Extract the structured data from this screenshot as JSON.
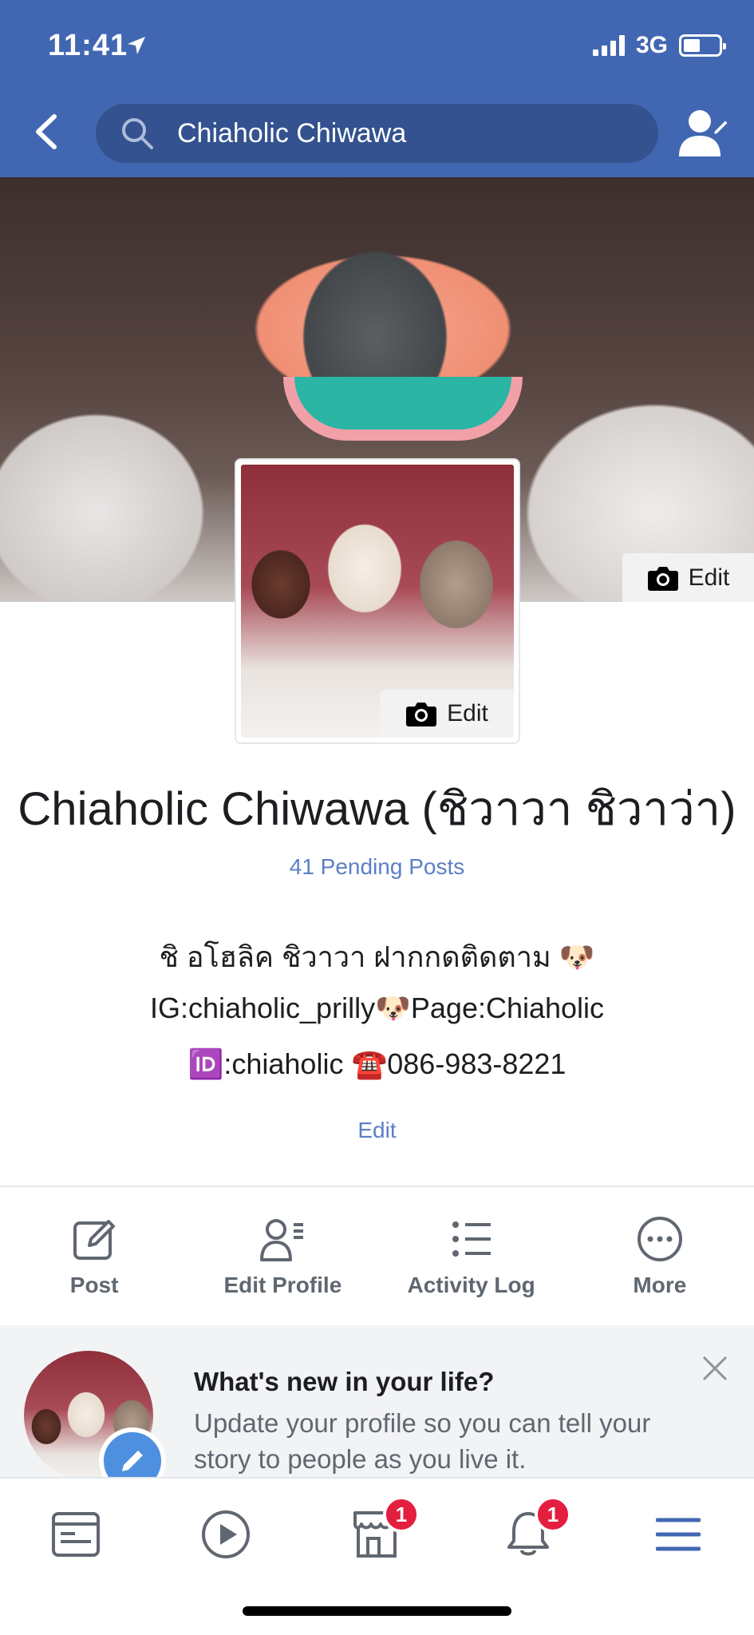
{
  "status_bar": {
    "time": "11:41",
    "network": "3G"
  },
  "header": {
    "search_text": "Chiaholic Chiwawa",
    "icons": [
      "back-chevron-icon",
      "search-icon",
      "profile-switch-icon"
    ],
    "background_color": "#4267b2"
  },
  "cover": {
    "edit_label": "Edit"
  },
  "profile_picture": {
    "edit_label": "Edit"
  },
  "profile": {
    "name": "Chiaholic Chiwawa (ชิวาวา ชิวาว่า)",
    "pending_posts": "41 Pending Posts",
    "bio_line1": "ชิ อโฮลิค ชิวาวา ฝากกดติดตาม 🐶",
    "bio_line2": "IG:chiaholic_prilly🐶Page:Chiaholic",
    "bio_line3": "🆔:chiaholic ☎️086-983-8221",
    "edit_label": "Edit"
  },
  "actions": [
    {
      "label": "Post",
      "icon": "compose-icon"
    },
    {
      "label": "Edit Profile",
      "icon": "edit-profile-icon"
    },
    {
      "label": "Activity Log",
      "icon": "list-icon"
    },
    {
      "label": "More",
      "icon": "more-icon"
    }
  ],
  "composer": {
    "title": "What's new in your life?",
    "subtitle": "Update your profile so you can tell your story to people as you live it."
  },
  "tabbar": {
    "tabs": [
      {
        "icon": "news-feed-icon"
      },
      {
        "icon": "watch-icon"
      },
      {
        "icon": "marketplace-icon",
        "badge": "1"
      },
      {
        "icon": "notifications-icon",
        "badge": "1"
      },
      {
        "icon": "menu-icon"
      }
    ],
    "active_color": "#4267b2"
  }
}
